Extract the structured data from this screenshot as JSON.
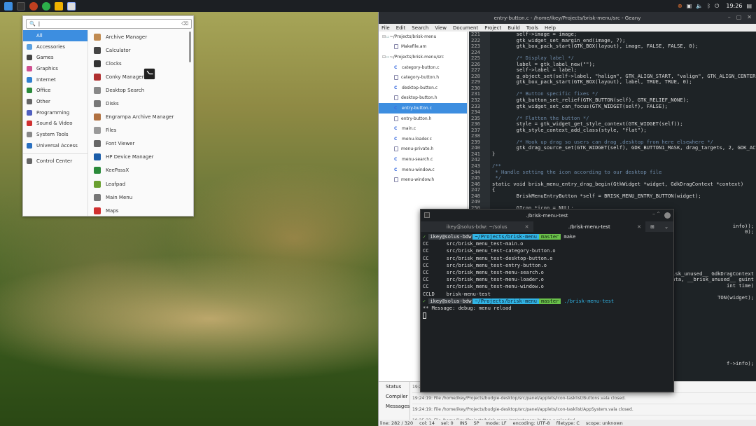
{
  "topbar": {
    "clock": "19:26",
    "tray_icons": [
      "update-icon",
      "network-icon",
      "volume-icon",
      "bluetooth-icon",
      "power-icon"
    ]
  },
  "menu": {
    "search_value": "|",
    "categories": [
      {
        "label": "All",
        "color": "#3d8ee0"
      },
      {
        "label": "Accessories",
        "color": "#5aa0e0"
      },
      {
        "label": "Games",
        "color": "#444444"
      },
      {
        "label": "Graphics",
        "color": "#d05090"
      },
      {
        "label": "Internet",
        "color": "#3080d0"
      },
      {
        "label": "Office",
        "color": "#2a8a3a"
      },
      {
        "label": "Other",
        "color": "#666666"
      },
      {
        "label": "Programming",
        "color": "#5060c0"
      },
      {
        "label": "Sound & Video",
        "color": "#d03030"
      },
      {
        "label": "System Tools",
        "color": "#888888"
      },
      {
        "label": "Universal Access",
        "color": "#2a70c0"
      },
      {
        "label": "Control Center",
        "color": "#666666"
      }
    ],
    "apps": [
      {
        "label": "Archive Manager",
        "color": "#c08a50"
      },
      {
        "label": "Calculator",
        "color": "#444444"
      },
      {
        "label": "Clocks",
        "color": "#333333"
      },
      {
        "label": "Conky Manager",
        "color": "#b03030"
      },
      {
        "label": "Desktop Search",
        "color": "#888888"
      },
      {
        "label": "Disks",
        "color": "#777777"
      },
      {
        "label": "Engrampa Archive Manager",
        "color": "#b07040"
      },
      {
        "label": "Files",
        "color": "#999999"
      },
      {
        "label": "Font Viewer",
        "color": "#666666"
      },
      {
        "label": "HP Device Manager",
        "color": "#1a5ca8"
      },
      {
        "label": "KeePassX",
        "color": "#2a8a3a"
      },
      {
        "label": "Leafpad",
        "color": "#6aa030"
      },
      {
        "label": "Main Menu",
        "color": "#777777"
      },
      {
        "label": "Maps",
        "color": "#d03030"
      }
    ]
  },
  "geany": {
    "title": "entry-button.c - /home/ikey/Projects/brisk-menu/src - Geany",
    "menu": [
      "File",
      "Edit",
      "Search",
      "View",
      "Document",
      "Project",
      "Build",
      "Tools",
      "Help"
    ],
    "sidebar": [
      {
        "label": "~/Projects/brisk-menu",
        "type": "folder"
      },
      {
        "label": "Makefile.am",
        "type": "file",
        "icon": "doc"
      },
      {
        "label": "~/Projects/brisk-menu/src",
        "type": "folder"
      },
      {
        "label": "category-button.c",
        "type": "file",
        "icon": "c"
      },
      {
        "label": "category-button.h",
        "type": "file",
        "icon": "doc"
      },
      {
        "label": "desktop-button.c",
        "type": "file",
        "icon": "c"
      },
      {
        "label": "desktop-button.h",
        "type": "file",
        "icon": "doc"
      },
      {
        "label": "entry-button.c",
        "type": "file",
        "icon": "c",
        "selected": true
      },
      {
        "label": "entry-button.h",
        "type": "file",
        "icon": "doc"
      },
      {
        "label": "main.c",
        "type": "file",
        "icon": "c"
      },
      {
        "label": "menu-loader.c",
        "type": "file",
        "icon": "c"
      },
      {
        "label": "menu-private.h",
        "type": "file",
        "icon": "doc"
      },
      {
        "label": "menu-search.c",
        "type": "file",
        "icon": "c"
      },
      {
        "label": "menu-window.c",
        "type": "file",
        "icon": "c"
      },
      {
        "label": "menu-window.h",
        "type": "file",
        "icon": "doc"
      }
    ],
    "line_numbers": [
      "221",
      "222",
      "223",
      "224",
      "225",
      "226",
      "227",
      "228",
      "229",
      "230",
      "231",
      "232",
      "233",
      "234",
      "235",
      "236",
      "237",
      "238",
      "239",
      "240",
      "241",
      "242",
      "243",
      "244",
      "245",
      "246",
      "247",
      "248",
      "249",
      "250"
    ],
    "code_lines": [
      "        self->image = image;",
      "        gtk_widget_set_margin_end(image, 7);",
      "        gtk_box_pack_start(GTK_BOX(layout), image, FALSE, FALSE, 0);",
      "",
      "        /* Display label */",
      "        label = gtk_label_new(\"\");",
      "        self->label = label;",
      "        g_object_set(self->label, \"halign\", GTK_ALIGN_START, \"valign\", GTK_ALIGN_CENTER, NULL);",
      "        gtk_box_pack_start(GTK_BOX(layout), label, TRUE, TRUE, 0);",
      "",
      "        /* Button specific fixes */",
      "        gtk_button_set_relief(GTK_BUTTON(self), GTK_RELIEF_NONE);",
      "        gtk_widget_set_can_focus(GTK_WIDGET(self), FALSE);",
      "",
      "        /* Flatten the button */",
      "        style = gtk_widget_get_style_context(GTK_WIDGET(self));",
      "        gtk_style_context_add_class(style, \"flat\");",
      "",
      "        /* Hook up drag so users can drag .desktop from here elsewhere */",
      "        gtk_drag_source_set(GTK_WIDGET(self), GDK_BUTTON1_MASK, drag_targets, 2, GDK_ACTION_COPY);",
      "}",
      "",
      "/**",
      " * Handle setting the icon according to our desktop file",
      " */",
      "static void brisk_menu_entry_drag_begin(GtkWidget *widget, GdkDragContext *context)",
      "{",
      "        BriskMenuEntryButton *self = BRISK_MENU_ENTRY_BUTTON(widget);",
      "",
      "        GIcon *icon = NULL;"
    ],
    "code_peek": [
      {
        "line": "info));",
        "row": 32
      },
      {
        "line": "0);",
        "row": 33
      },
      {
        "line": "__brisk_unused__ GdkDragContext",
        "row": 40
      },
      {
        "line": "ata, __brisk_unused__ guint",
        "row": 41
      },
      {
        "line": "int time)",
        "row": 42
      },
      {
        "line": "TON(widget);",
        "row": 44
      },
      {
        "line": "f->info);",
        "row": 55
      }
    ],
    "msg_tabs": [
      "Status",
      "Compiler",
      "Messages"
    ],
    "messages": [
      "19:24:19: File /home/ikey/Projects/budgie-desktop/src/panel/applets/icon-tasklist/Buttons.vala closed.",
      "19:24:19: File /home/ikey/Projects/budgie-desktop/src/panel/applets/icon-tasklist/AppSystem.vala closed.",
      "19:25:22: File /home/ikey/Projects/brisk-menu/src/category-button.c reloaded."
    ],
    "msg_first": "19:2",
    "status": [
      "line: 282 / 320",
      "col: 14",
      "sel: 0",
      "INS",
      "SP",
      "mode: LF",
      "encoding: UTF-8",
      "filetype: C",
      "scope: unknown"
    ]
  },
  "terminal": {
    "title": "./brisk-menu-test",
    "tabs": [
      "ikey@solus-bdw: ~/solus",
      "./brisk-menu-test"
    ],
    "prompt_user": "ikey@solus-bdw",
    "prompt_path": "~/Projects/brisk-menu",
    "prompt_branch": "master",
    "cmd1": "make",
    "output": [
      "CC      src/brisk_menu_test-main.o",
      "CC      src/brisk_menu_test-category-button.o",
      "CC      src/brisk_menu_test-desktop-button.o",
      "CC      src/brisk_menu_test-entry-button.o",
      "CC      src/brisk_menu_test-menu-search.o",
      "CC      src/brisk_menu_test-menu-loader.o",
      "CC      src/brisk_menu_test-menu-window.o",
      "CCLD    brisk-menu-test"
    ],
    "cmd2": "./brisk-menu-test",
    "message": "** Message: debug: menu reload"
  }
}
